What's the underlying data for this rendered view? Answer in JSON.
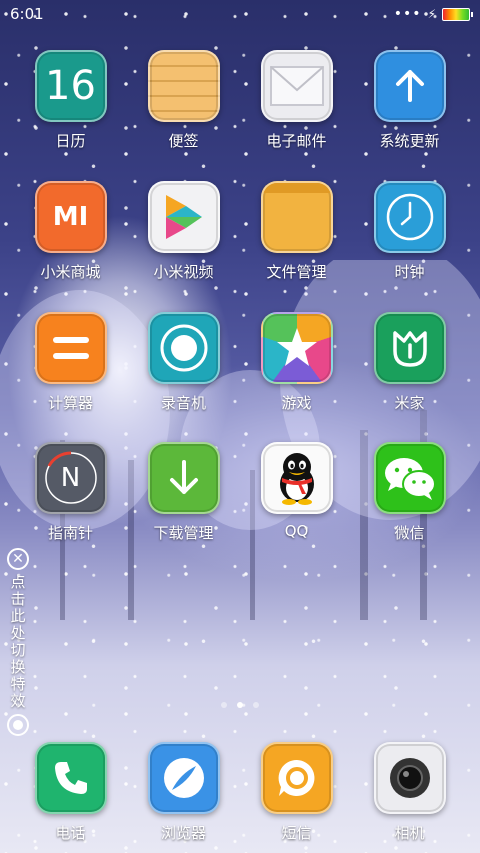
{
  "status_bar": {
    "time": "6:01",
    "menu_dots": "•••",
    "charging_glyph": "⚡"
  },
  "apps": [
    {
      "label": "日历",
      "icon": "calendar-icon",
      "icon_text": "16"
    },
    {
      "label": "便签",
      "icon": "notes-icon"
    },
    {
      "label": "电子邮件",
      "icon": "email-icon"
    },
    {
      "label": "系统更新",
      "icon": "system-update-icon"
    },
    {
      "label": "小米商城",
      "icon": "mi-store-icon",
      "icon_text": "MI"
    },
    {
      "label": "小米视频",
      "icon": "mi-video-icon"
    },
    {
      "label": "文件管理",
      "icon": "file-manager-icon"
    },
    {
      "label": "时钟",
      "icon": "clock-icon"
    },
    {
      "label": "计算器",
      "icon": "calculator-icon"
    },
    {
      "label": "录音机",
      "icon": "recorder-icon"
    },
    {
      "label": "游戏",
      "icon": "games-icon"
    },
    {
      "label": "米家",
      "icon": "mijia-icon"
    },
    {
      "label": "指南针",
      "icon": "compass-icon",
      "icon_text": "N"
    },
    {
      "label": "下载管理",
      "icon": "download-manager-icon"
    },
    {
      "label": "QQ",
      "icon": "qq-icon"
    },
    {
      "label": "微信",
      "icon": "wechat-icon"
    }
  ],
  "dock": [
    {
      "label": "电话",
      "icon": "phone-icon"
    },
    {
      "label": "浏览器",
      "icon": "browser-icon"
    },
    {
      "label": "短信",
      "icon": "messages-icon"
    },
    {
      "label": "相机",
      "icon": "camera-icon"
    }
  ],
  "side_toggle": {
    "text": "点击此处切换特效",
    "close_glyph": "✕"
  },
  "pages": {
    "count": 3,
    "active": 2
  },
  "colors": {
    "calendar": "#1a9a8c",
    "notes": "#f0b860",
    "email": "#e6e6ea",
    "update": "#2f8fe0",
    "mi_store": "#f26a2c",
    "files": "#f2b340",
    "clock": "#2a9ed8",
    "calculator": "#f7821e",
    "recorder": "#1fa6b8",
    "mijia": "#1aa05c",
    "compass": "#555a66",
    "download": "#5cb83a",
    "wechat": "#2ec11a",
    "phone": "#1fb46e",
    "browser": "#3a92e6",
    "messages": "#f5a623",
    "camera": "#e8e8ec"
  }
}
